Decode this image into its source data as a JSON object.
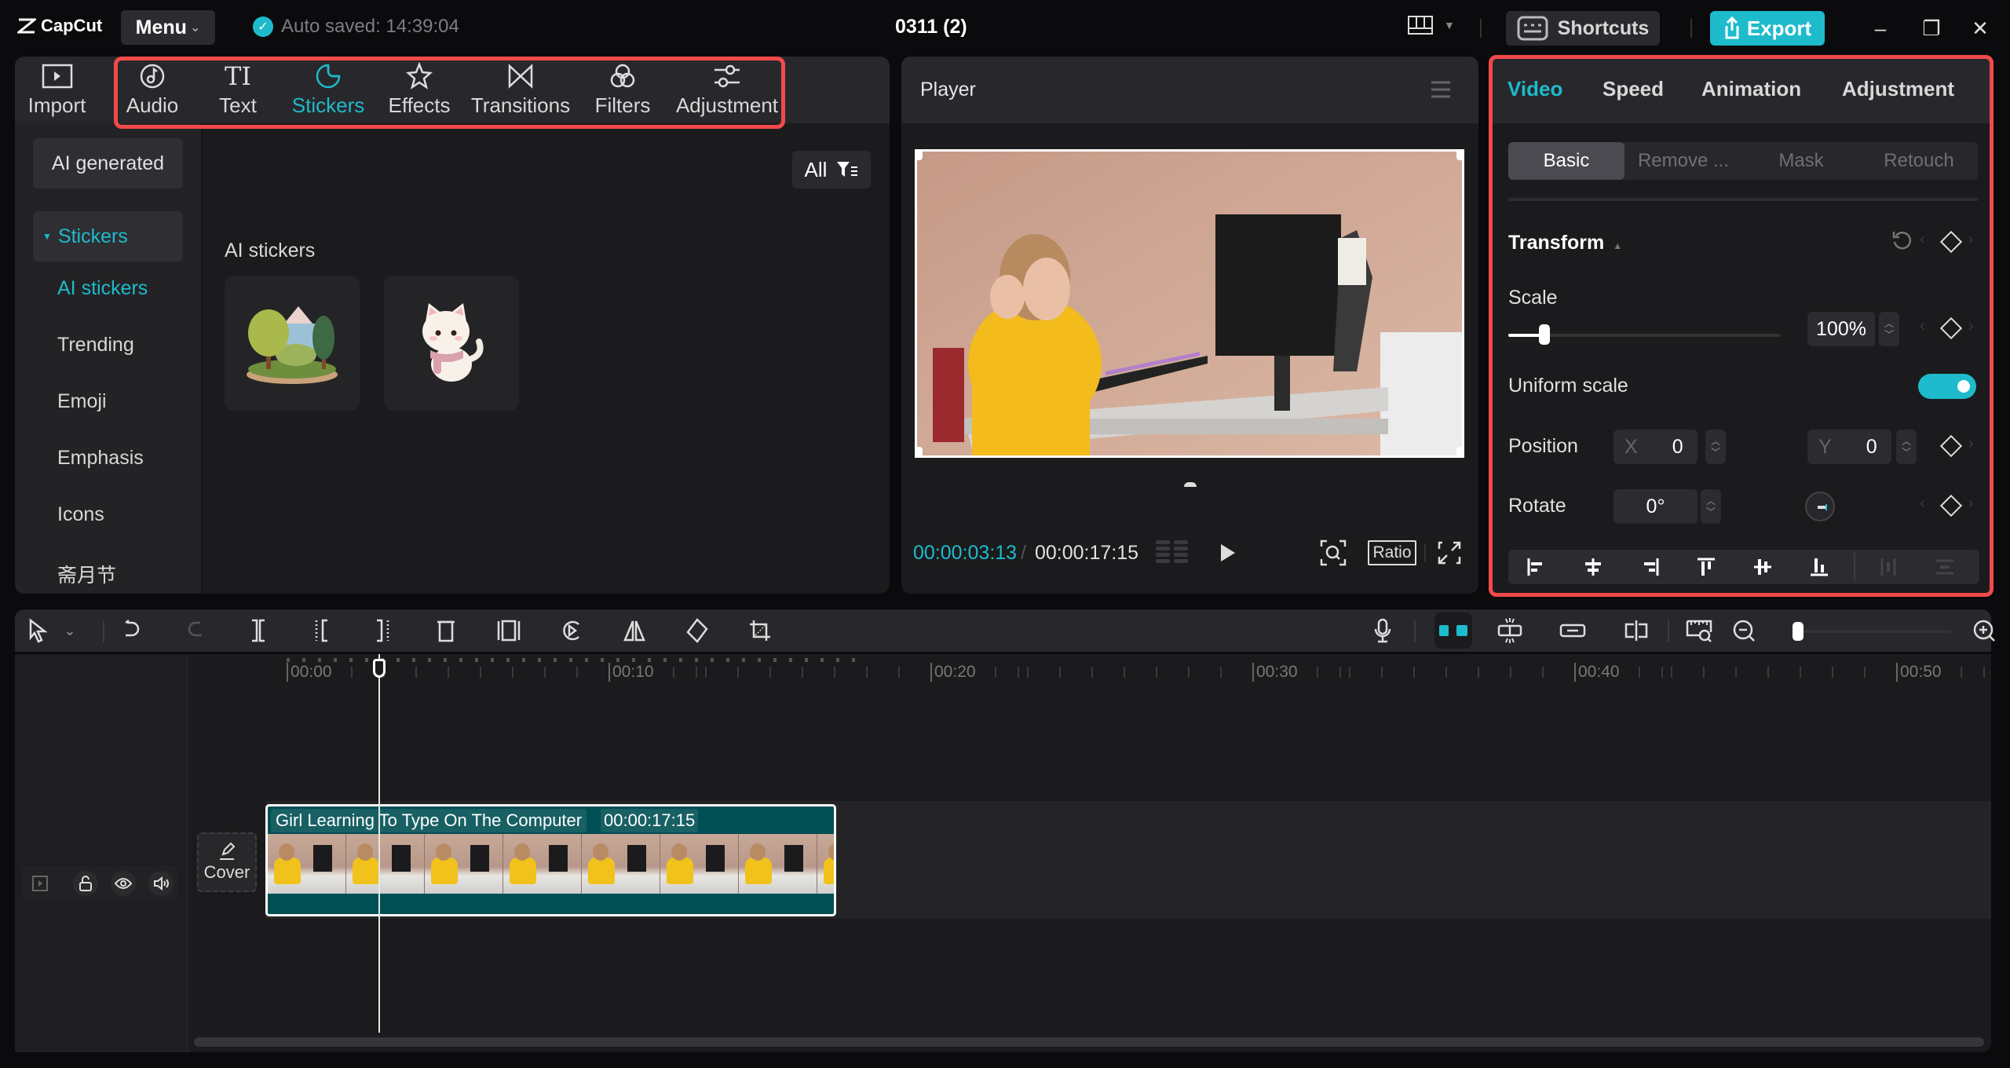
{
  "titlebar": {
    "app_name": "CapCut",
    "menu_label": "Menu",
    "autosave_text": "Auto saved: 14:39:04",
    "project_title": "0311 (2)",
    "shortcuts_label": "Shortcuts",
    "export_label": "Export"
  },
  "media_tabs": [
    {
      "label": "Import",
      "icon": "import-icon"
    },
    {
      "label": "Audio",
      "icon": "audio-icon"
    },
    {
      "label": "Text",
      "icon": "text-icon"
    },
    {
      "label": "Stickers",
      "icon": "stickers-icon",
      "active": true
    },
    {
      "label": "Effects",
      "icon": "effects-icon"
    },
    {
      "label": "Transitions",
      "icon": "transitions-icon"
    },
    {
      "label": "Filters",
      "icon": "filters-icon"
    },
    {
      "label": "Adjustment",
      "icon": "adjustment-icon"
    }
  ],
  "sidebar": {
    "ai_generated": "AI generated",
    "stickers_group": "Stickers",
    "items": [
      {
        "label": "AI stickers",
        "active": true
      },
      {
        "label": "Trending"
      },
      {
        "label": "Emoji"
      },
      {
        "label": "Emphasis"
      },
      {
        "label": "Icons"
      },
      {
        "label": "斋月节"
      }
    ]
  },
  "stickers_panel": {
    "filter_label": "All",
    "section_title": "AI stickers",
    "items": [
      {
        "name": "forest-landscape-sticker"
      },
      {
        "name": "cat-with-scarf-sticker"
      }
    ]
  },
  "player": {
    "title": "Player",
    "current_time": "00:00:03:13",
    "separator": "/",
    "total_time": "00:00:17:15",
    "ratio_label": "Ratio"
  },
  "inspector": {
    "tabs": [
      {
        "label": "Video",
        "active": true
      },
      {
        "label": "Speed"
      },
      {
        "label": "Animation"
      },
      {
        "label": "Adjustment"
      }
    ],
    "subtabs": [
      {
        "label": "Basic",
        "active": true
      },
      {
        "label": "Remove ..."
      },
      {
        "label": "Mask"
      },
      {
        "label": "Retouch"
      }
    ],
    "section_title": "Transform",
    "scale_label": "Scale",
    "scale_value": "100%",
    "scale_percent": 100,
    "uniform_scale_label": "Uniform scale",
    "uniform_scale_on": true,
    "position_label": "Position",
    "x_label": "X",
    "x_value": "0",
    "y_label": "Y",
    "y_value": "0",
    "rotate_label": "Rotate",
    "rotate_value": "0°"
  },
  "timeline": {
    "ruler_labels": [
      "00:00",
      "00:10",
      "00:20",
      "00:30",
      "00:40",
      "00:50"
    ],
    "clip": {
      "title": "Girl Learning To Type On The Computer",
      "duration": "00:00:17:15"
    },
    "cover_label": "Cover",
    "playhead_time": "00:00:03:13"
  },
  "colors": {
    "accent": "#1ebbcc",
    "highlight_box": "#f24a4a",
    "clip_bg": "#004f55"
  }
}
